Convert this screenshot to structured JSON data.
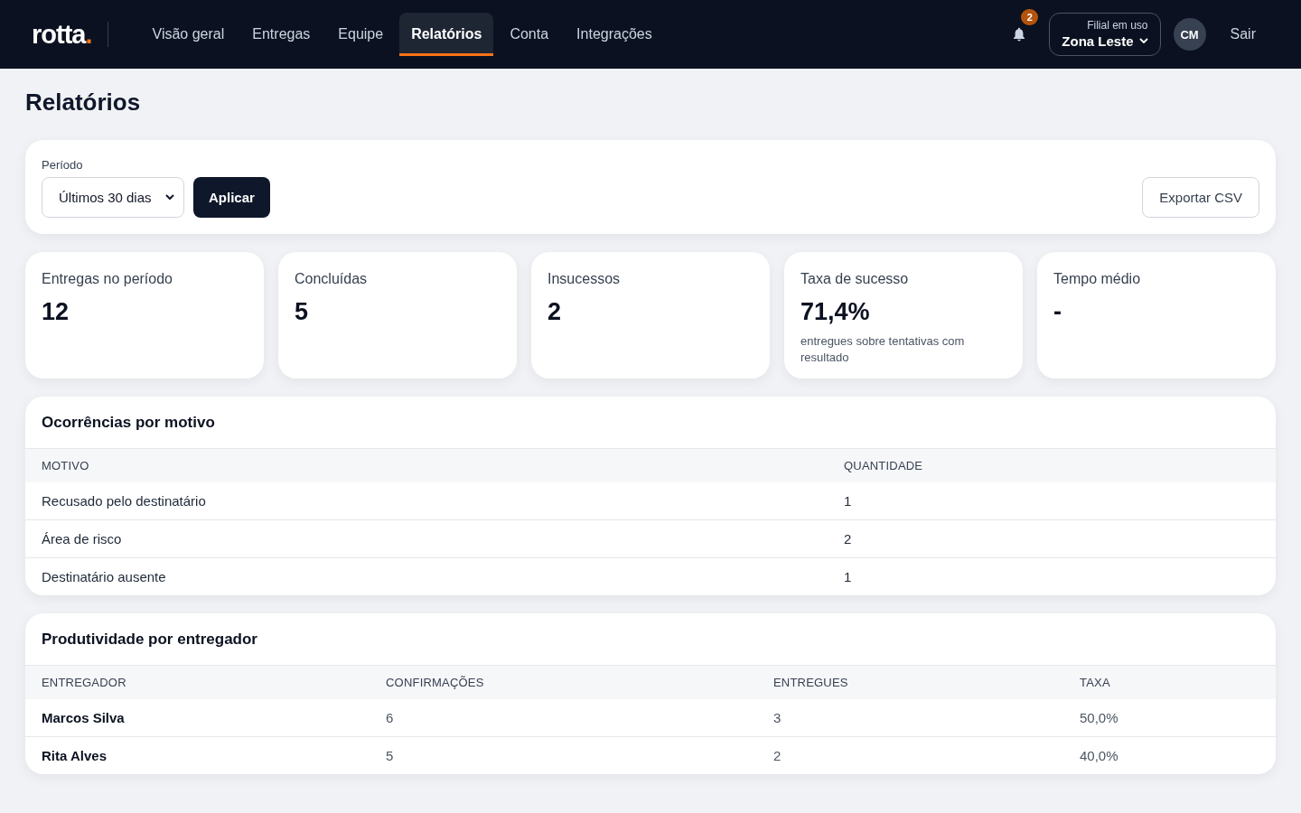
{
  "header": {
    "logo": {
      "text": "rotta",
      "accent": "."
    },
    "nav": [
      {
        "label": "Visão geral",
        "selected": false
      },
      {
        "label": "Entregas",
        "selected": false
      },
      {
        "label": "Equipe",
        "selected": false
      },
      {
        "label": "Relatórios",
        "selected": true
      },
      {
        "label": "Conta",
        "selected": false
      },
      {
        "label": "Integrações",
        "selected": false
      }
    ],
    "notifications": {
      "count": "2"
    },
    "branch": {
      "caption": "Filial em uso",
      "value": "Zona Leste"
    },
    "avatar": "CM",
    "logout": "Sair"
  },
  "page_title": "Relatórios",
  "filters": {
    "period": {
      "label": "Período",
      "value": "Últimos 30 dias"
    },
    "apply": "Aplicar",
    "export": "Exportar CSV"
  },
  "stats": [
    {
      "label": "Entregas no período",
      "value": "12"
    },
    {
      "label": "Concluídas",
      "value": "5"
    },
    {
      "label": "Insucessos",
      "value": "2"
    },
    {
      "label": "Taxa de sucesso",
      "value": "71,4%",
      "note": "entregues sobre tentativas com resultado"
    },
    {
      "label": "Tempo médio",
      "value": "-"
    }
  ],
  "tables": [
    {
      "kind": "reasons",
      "title": "Ocorrências por motivo",
      "columns": [
        "MOTIVO",
        "QUANTIDADE"
      ],
      "rows": [
        [
          "Recusado pelo destinatário",
          "1"
        ],
        [
          "Área de risco",
          "2"
        ],
        [
          "Destinatário ausente",
          "1"
        ]
      ]
    },
    {
      "kind": "people",
      "title": "Produtividade por entregador",
      "columns": [
        "ENTREGADOR",
        "CONFIRMAÇÕES",
        "ENTREGUES",
        "TAXA"
      ],
      "rows": [
        [
          "Marcos Silva",
          "6",
          "3",
          "50,0%"
        ],
        [
          "Rita Alves",
          "5",
          "2",
          "40,0%"
        ]
      ]
    }
  ]
}
